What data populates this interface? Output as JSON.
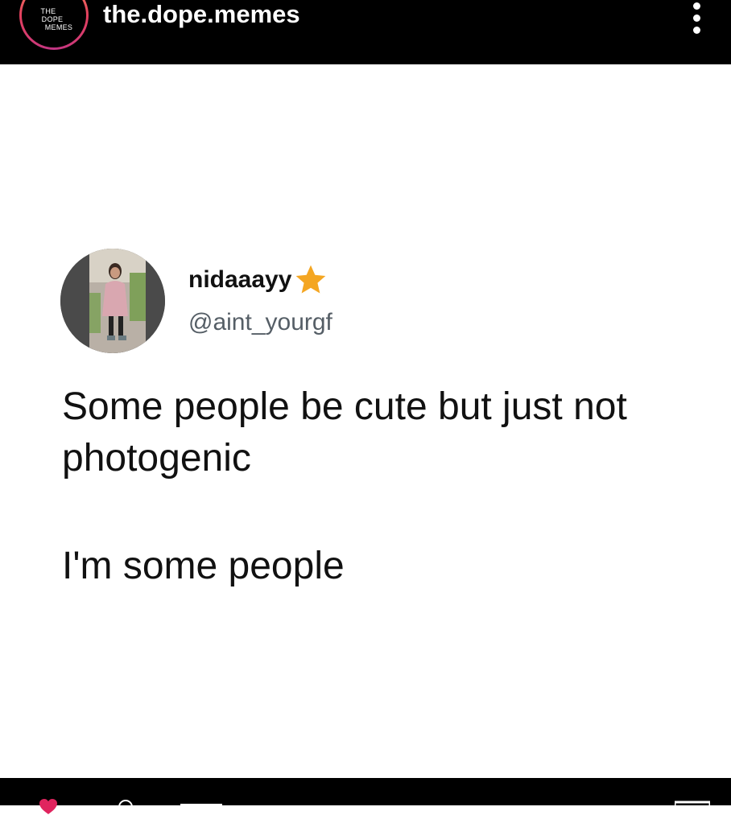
{
  "header": {
    "account_name": "the.dope.memes",
    "logo_lines": [
      "THE",
      "DOPE",
      "MEMES"
    ],
    "more_icon": "more-vertical-icon"
  },
  "tweet": {
    "display_name": "nidaaayy",
    "badge_icon": "star-icon",
    "handle": "@aint_yourgf",
    "text_line1": "Some people be cute but just not photogenic",
    "text_line2": "I'm some people"
  },
  "bottom_bar": {
    "icons": [
      "heart-icon",
      "comment-icon",
      "share-icon",
      "save-icon"
    ]
  },
  "colors": {
    "header_bg": "#000000",
    "page_bg": "#ffffff",
    "star": "#f4a622",
    "handle": "#555e66",
    "heart": "#e0245e"
  }
}
